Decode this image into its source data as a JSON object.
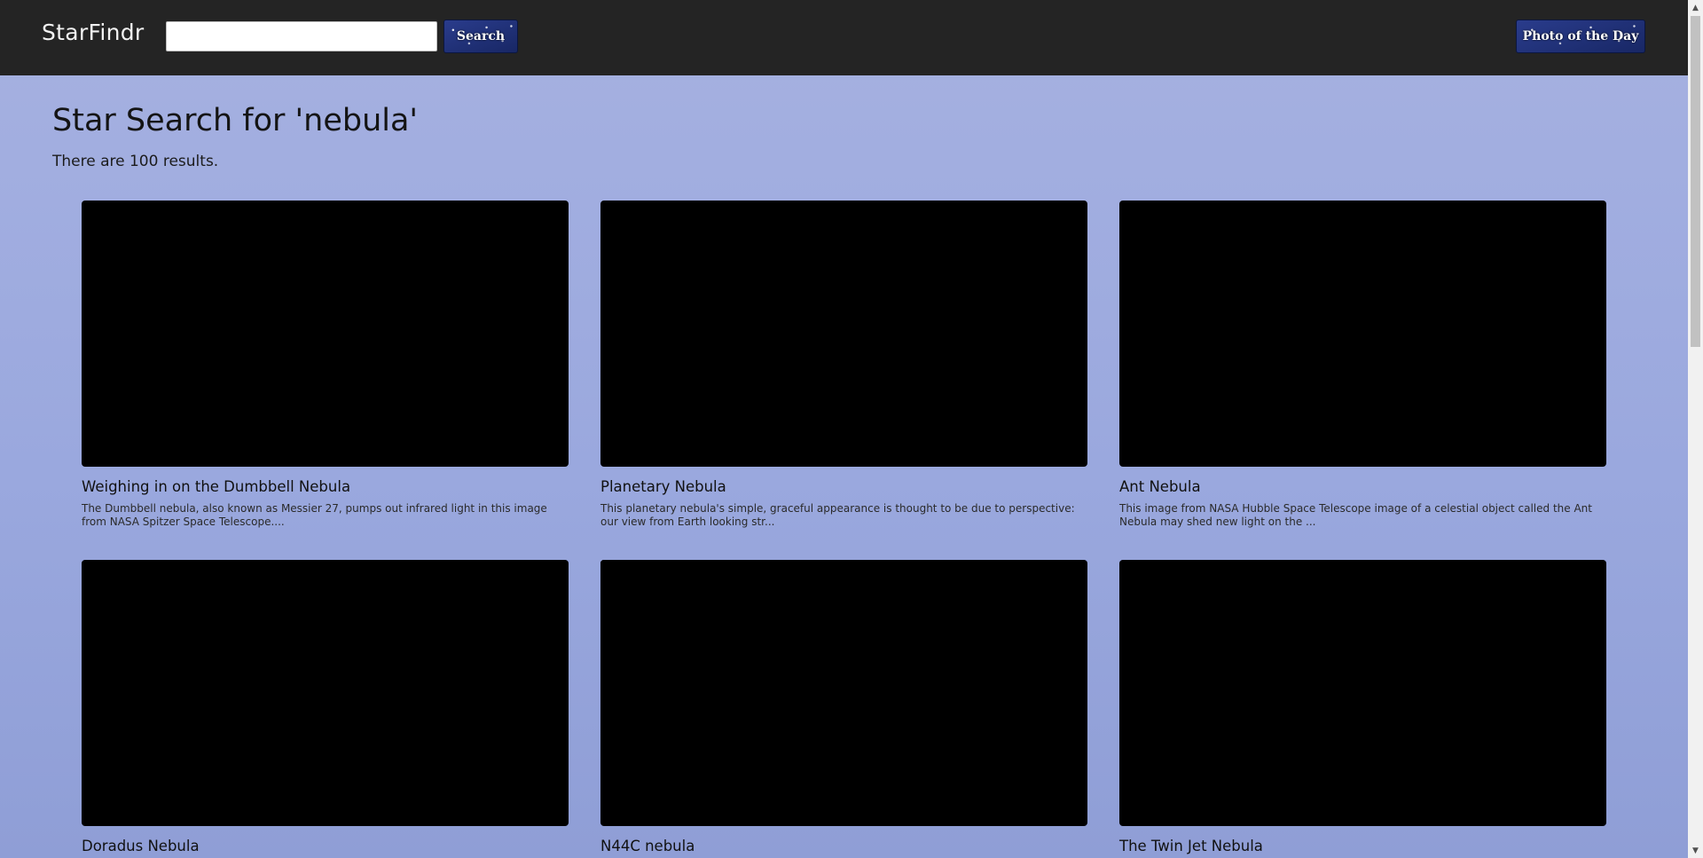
{
  "navbar": {
    "brand": "StarFindr",
    "search": {
      "value": "",
      "placeholder": "",
      "button_label": "Search"
    },
    "photo_of_day_label": "Photo of the Day"
  },
  "main": {
    "heading": "Star Search for 'nebula'",
    "result_count": "There are 100 results."
  },
  "results": [
    {
      "title": "Weighing in on the Dumbbell Nebula",
      "description": "The Dumbbell nebula, also known as Messier 27, pumps out infrared light in this image from NASA Spitzer Space Telescope....",
      "image": "dumbbell-nebula-photo"
    },
    {
      "title": "Planetary Nebula",
      "description": "This planetary nebula's simple, graceful appearance is thought to be due to perspective: our view from Earth looking str...",
      "image": "ring-nebula-photo"
    },
    {
      "title": "Ant Nebula",
      "description": "This image from NASA Hubble Space Telescope image of a celestial object called the Ant Nebula may shed new light on the ...",
      "image": "ant-nebula-photo"
    },
    {
      "title": "Doradus Nebula",
      "description": "",
      "image": "doradus-nebula-photo"
    },
    {
      "title": "N44C nebula",
      "description": "",
      "image": "n44c-nebula-photo"
    },
    {
      "title": "The Twin Jet Nebula",
      "description": "",
      "image": "twin-jet-nebula-photo"
    }
  ],
  "scrollbar": {
    "up_icon": "▲",
    "down_icon": "▼"
  }
}
